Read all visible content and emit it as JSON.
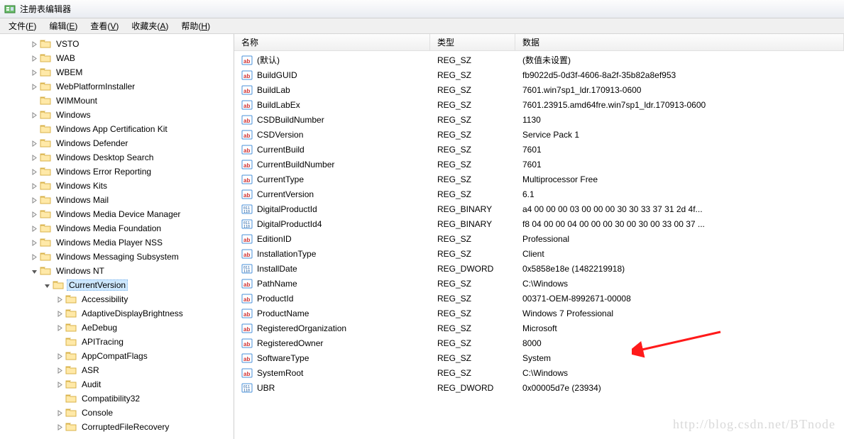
{
  "window": {
    "title": "注册表编辑器"
  },
  "menubar": [
    {
      "label": "文件",
      "accel": "F"
    },
    {
      "label": "编辑",
      "accel": "E"
    },
    {
      "label": "查看",
      "accel": "V"
    },
    {
      "label": "收藏夹",
      "accel": "A"
    },
    {
      "label": "帮助",
      "accel": "H"
    }
  ],
  "tree": {
    "items": [
      {
        "depth": 2,
        "label": "VSTO",
        "exp": "closed"
      },
      {
        "depth": 2,
        "label": "WAB",
        "exp": "closed"
      },
      {
        "depth": 2,
        "label": "WBEM",
        "exp": "closed"
      },
      {
        "depth": 2,
        "label": "WebPlatformInstaller",
        "exp": "closed"
      },
      {
        "depth": 2,
        "label": "WIMMount",
        "exp": "none"
      },
      {
        "depth": 2,
        "label": "Windows",
        "exp": "closed"
      },
      {
        "depth": 2,
        "label": "Windows App Certification Kit",
        "exp": "none"
      },
      {
        "depth": 2,
        "label": "Windows Defender",
        "exp": "closed"
      },
      {
        "depth": 2,
        "label": "Windows Desktop Search",
        "exp": "closed"
      },
      {
        "depth": 2,
        "label": "Windows Error Reporting",
        "exp": "closed"
      },
      {
        "depth": 2,
        "label": "Windows Kits",
        "exp": "closed"
      },
      {
        "depth": 2,
        "label": "Windows Mail",
        "exp": "closed"
      },
      {
        "depth": 2,
        "label": "Windows Media Device Manager",
        "exp": "closed"
      },
      {
        "depth": 2,
        "label": "Windows Media Foundation",
        "exp": "closed"
      },
      {
        "depth": 2,
        "label": "Windows Media Player NSS",
        "exp": "closed"
      },
      {
        "depth": 2,
        "label": "Windows Messaging Subsystem",
        "exp": "closed"
      },
      {
        "depth": 2,
        "label": "Windows NT",
        "exp": "open"
      },
      {
        "depth": 3,
        "label": "CurrentVersion",
        "exp": "open",
        "selected": true
      },
      {
        "depth": 4,
        "label": "Accessibility",
        "exp": "closed"
      },
      {
        "depth": 4,
        "label": "AdaptiveDisplayBrightness",
        "exp": "closed"
      },
      {
        "depth": 4,
        "label": "AeDebug",
        "exp": "closed"
      },
      {
        "depth": 4,
        "label": "APITracing",
        "exp": "none"
      },
      {
        "depth": 4,
        "label": "AppCompatFlags",
        "exp": "closed"
      },
      {
        "depth": 4,
        "label": "ASR",
        "exp": "closed"
      },
      {
        "depth": 4,
        "label": "Audit",
        "exp": "closed"
      },
      {
        "depth": 4,
        "label": "Compatibility32",
        "exp": "none"
      },
      {
        "depth": 4,
        "label": "Console",
        "exp": "closed"
      },
      {
        "depth": 4,
        "label": "CorruptedFileRecovery",
        "exp": "closed"
      }
    ]
  },
  "list": {
    "cols": {
      "name": "名称",
      "type": "类型",
      "data": "数据"
    },
    "rows": [
      {
        "icon": "sz",
        "name": "(默认)",
        "type": "REG_SZ",
        "data": "(数值未设置)"
      },
      {
        "icon": "sz",
        "name": "BuildGUID",
        "type": "REG_SZ",
        "data": "fb9022d5-0d3f-4606-8a2f-35b82a8ef953"
      },
      {
        "icon": "sz",
        "name": "BuildLab",
        "type": "REG_SZ",
        "data": "7601.win7sp1_ldr.170913-0600"
      },
      {
        "icon": "sz",
        "name": "BuildLabEx",
        "type": "REG_SZ",
        "data": "7601.23915.amd64fre.win7sp1_ldr.170913-0600"
      },
      {
        "icon": "sz",
        "name": "CSDBuildNumber",
        "type": "REG_SZ",
        "data": "1130"
      },
      {
        "icon": "sz",
        "name": "CSDVersion",
        "type": "REG_SZ",
        "data": "Service Pack 1"
      },
      {
        "icon": "sz",
        "name": "CurrentBuild",
        "type": "REG_SZ",
        "data": "7601"
      },
      {
        "icon": "sz",
        "name": "CurrentBuildNumber",
        "type": "REG_SZ",
        "data": "7601"
      },
      {
        "icon": "sz",
        "name": "CurrentType",
        "type": "REG_SZ",
        "data": "Multiprocessor Free"
      },
      {
        "icon": "sz",
        "name": "CurrentVersion",
        "type": "REG_SZ",
        "data": "6.1"
      },
      {
        "icon": "bin",
        "name": "DigitalProductId",
        "type": "REG_BINARY",
        "data": "a4 00 00 00 03 00 00 00 30 30 33 37 31 2d 4f..."
      },
      {
        "icon": "bin",
        "name": "DigitalProductId4",
        "type": "REG_BINARY",
        "data": "f8 04 00 00 04 00 00 00 30 00 30 00 33 00 37 ..."
      },
      {
        "icon": "sz",
        "name": "EditionID",
        "type": "REG_SZ",
        "data": "Professional"
      },
      {
        "icon": "sz",
        "name": "InstallationType",
        "type": "REG_SZ",
        "data": "Client"
      },
      {
        "icon": "bin",
        "name": "InstallDate",
        "type": "REG_DWORD",
        "data": "0x5858e18e (1482219918)"
      },
      {
        "icon": "sz",
        "name": "PathName",
        "type": "REG_SZ",
        "data": "C:\\Windows"
      },
      {
        "icon": "sz",
        "name": "ProductId",
        "type": "REG_SZ",
        "data": "00371-OEM-8992671-00008"
      },
      {
        "icon": "sz",
        "name": "ProductName",
        "type": "REG_SZ",
        "data": "Windows 7 Professional"
      },
      {
        "icon": "sz",
        "name": "RegisteredOrganization",
        "type": "REG_SZ",
        "data": "Microsoft"
      },
      {
        "icon": "sz",
        "name": "RegisteredOwner",
        "type": "REG_SZ",
        "data": "8000"
      },
      {
        "icon": "sz",
        "name": "SoftwareType",
        "type": "REG_SZ",
        "data": "System"
      },
      {
        "icon": "sz",
        "name": "SystemRoot",
        "type": "REG_SZ",
        "data": "C:\\Windows"
      },
      {
        "icon": "bin",
        "name": "UBR",
        "type": "REG_DWORD",
        "data": "0x00005d7e (23934)"
      }
    ]
  },
  "watermark": "http://blog.csdn.net/BTnode"
}
